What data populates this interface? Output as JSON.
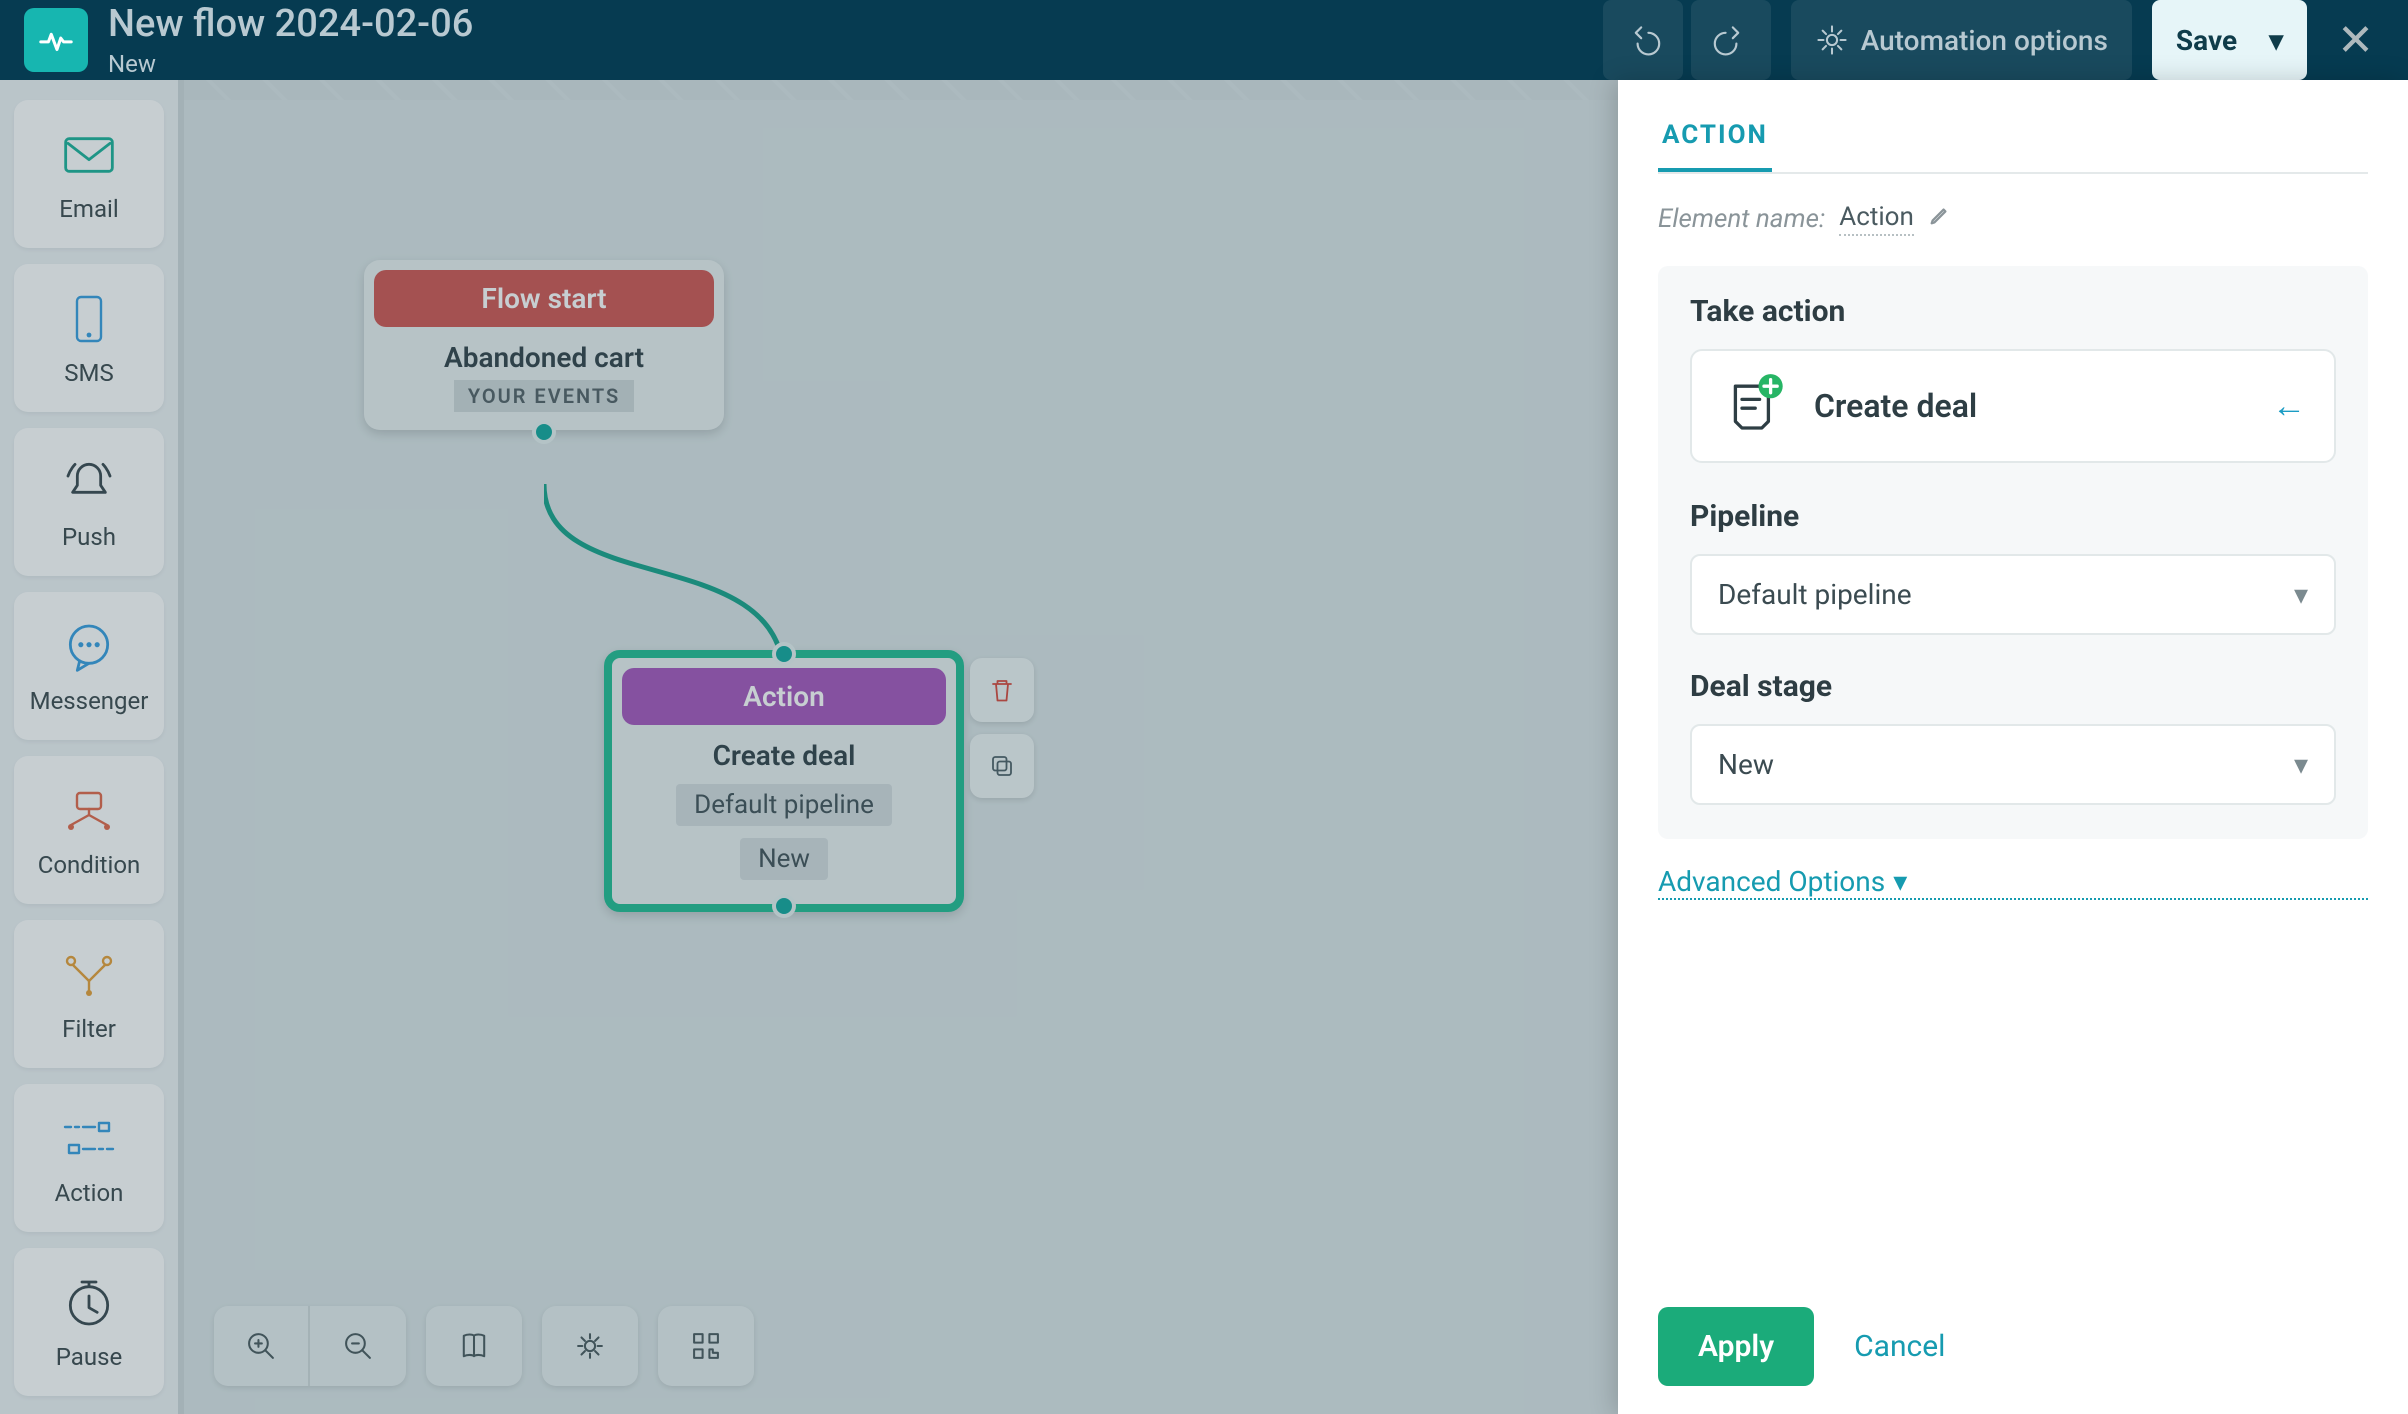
{
  "header": {
    "title": "New flow 2024-02-06",
    "status": "New",
    "automation_options": "Automation options",
    "save": "Save"
  },
  "palette": [
    {
      "key": "email",
      "label": "Email",
      "color": "#1eb39b"
    },
    {
      "key": "sms",
      "label": "SMS",
      "color": "#3a9fe0"
    },
    {
      "key": "push",
      "label": "Push",
      "color": "#3c4b52"
    },
    {
      "key": "messenger",
      "label": "Messenger",
      "color": "#3a9fe0"
    },
    {
      "key": "condition",
      "label": "Condition",
      "color": "#e36a4c"
    },
    {
      "key": "filter",
      "label": "Filter",
      "color": "#e7a13a"
    },
    {
      "key": "action",
      "label": "Action",
      "color": "#3a9fe0"
    },
    {
      "key": "pause",
      "label": "Pause",
      "color": "#3c4b52"
    }
  ],
  "nodes": {
    "start": {
      "header": "Flow start",
      "title": "Abandoned cart",
      "badge": "YOUR EVENTS"
    },
    "action": {
      "header": "Action",
      "title": "Create deal",
      "pipeline_chip": "Default pipeline",
      "stage_chip": "New"
    }
  },
  "panel": {
    "tab": "ACTION",
    "element_name_label": "Element name:",
    "element_name_value": "Action",
    "take_action_label": "Take action",
    "action_title": "Create deal",
    "pipeline_label": "Pipeline",
    "pipeline_value": "Default pipeline",
    "deal_stage_label": "Deal stage",
    "deal_stage_value": "New",
    "advanced_options": "Advanced Options",
    "apply": "Apply",
    "cancel": "Cancel"
  }
}
